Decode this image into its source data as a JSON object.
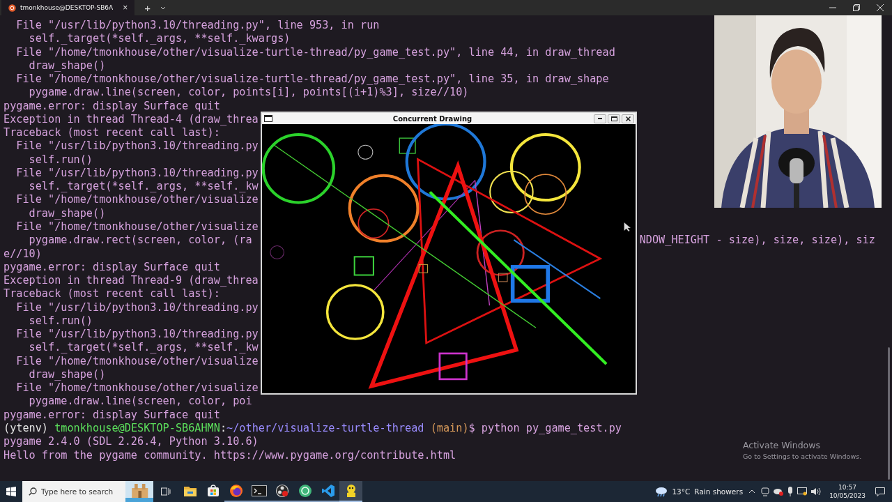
{
  "terminal": {
    "tab": {
      "title": "tmonkhouse@DESKTOP-SB6A",
      "close": "×"
    },
    "new_tab": "+",
    "lines": [
      {
        "kind": "text",
        "text": "  File \"/usr/lib/python3.10/threading.py\", line 953, in run"
      },
      {
        "kind": "text",
        "text": "    self._target(*self._args, **self._kwargs)"
      },
      {
        "kind": "text",
        "text": "  File \"/home/tmonkhouse/other/visualize-turtle-thread/py_game_test.py\", line 44, in draw_thread"
      },
      {
        "kind": "text",
        "text": "    draw_shape()"
      },
      {
        "kind": "text",
        "text": "  File \"/home/tmonkhouse/other/visualize-turtle-thread/py_game_test.py\", line 35, in draw_shape"
      },
      {
        "kind": "text",
        "text": "    pygame.draw.line(screen, color, points[i], points[(i+1)%3], size//10)"
      },
      {
        "kind": "text",
        "text": "pygame.error: display Surface quit"
      },
      {
        "kind": "text",
        "text": "Exception in thread Thread-4 (draw_threa"
      },
      {
        "kind": "text",
        "text": "Traceback (most recent call last):"
      },
      {
        "kind": "text",
        "text": "  File \"/usr/lib/python3.10/threading.py"
      },
      {
        "kind": "text",
        "text": "    self.run()"
      },
      {
        "kind": "text",
        "text": "  File \"/usr/lib/python3.10/threading.py"
      },
      {
        "kind": "text",
        "text": "    self._target(*self._args, **self._kw"
      },
      {
        "kind": "text",
        "text": "  File \"/home/tmonkhouse/other/visualize"
      },
      {
        "kind": "text",
        "text": "    draw_shape()"
      },
      {
        "kind": "text",
        "text": "  File \"/home/tmonkhouse/other/visualize"
      },
      {
        "kind": "split",
        "left": "    pygame.draw.rect(screen, color, (ra",
        "right": "NDOW_HEIGHT - size), size, size), siz"
      },
      {
        "kind": "text",
        "text": "e//10)"
      },
      {
        "kind": "text",
        "text": "pygame.error: display Surface quit"
      },
      {
        "kind": "text",
        "text": "Exception in thread Thread-9 (draw_threa"
      },
      {
        "kind": "text",
        "text": "Traceback (most recent call last):"
      },
      {
        "kind": "text",
        "text": "  File \"/usr/lib/python3.10/threading.py"
      },
      {
        "kind": "text",
        "text": "    self.run()"
      },
      {
        "kind": "text",
        "text": "  File \"/usr/lib/python3.10/threading.py"
      },
      {
        "kind": "text",
        "text": "    self._target(*self._args, **self._kw"
      },
      {
        "kind": "text",
        "text": "  File \"/home/tmonkhouse/other/visualize"
      },
      {
        "kind": "text",
        "text": "    draw_shape()"
      },
      {
        "kind": "text",
        "text": "  File \"/home/tmonkhouse/other/visualize"
      },
      {
        "kind": "text",
        "text": "    pygame.draw.line(screen, color, poi"
      },
      {
        "kind": "text",
        "text": "pygame.error: display Surface quit"
      },
      {
        "kind": "prompt",
        "segments": [
          {
            "kind": "env",
            "text": "(ytenv) "
          },
          {
            "kind": "user",
            "text": "tmonkhouse@DESKTOP-SB6AHMN"
          },
          {
            "kind": "sep",
            "text": ":"
          },
          {
            "kind": "path",
            "text": "~/other/visualize-turtle-thread"
          },
          {
            "kind": "branch",
            "text": " (main)"
          },
          {
            "kind": "command",
            "text": "$ python py_game_test.py"
          }
        ]
      },
      {
        "kind": "text",
        "text": "pygame 2.4.0 (SDL 2.26.4, Python 3.10.6)"
      },
      {
        "kind": "text",
        "text": "Hello from the pygame community. https://www.pygame.org/contribute.html"
      }
    ]
  },
  "pygame_window": {
    "title": "Concurrent Drawing"
  },
  "activation": {
    "title": "Activate Windows",
    "subtitle": "Go to Settings to activate Windows."
  },
  "taskbar": {
    "search": {
      "placeholder": "Type here to search"
    },
    "apps": [
      {
        "kind": "explorer",
        "running": false,
        "selected": false
      },
      {
        "kind": "store",
        "running": false,
        "selected": false
      },
      {
        "kind": "firefox",
        "running": true,
        "selected": false
      },
      {
        "kind": "terminal",
        "running": true,
        "selected": false
      },
      {
        "kind": "obs",
        "running": true,
        "selected": false
      },
      {
        "kind": "orb",
        "running": true,
        "selected": false
      },
      {
        "kind": "vscode",
        "running": true,
        "selected": false
      },
      {
        "kind": "pygame",
        "running": true,
        "selected": true
      }
    ],
    "weather": {
      "temperature": "13°C",
      "condition": "Rain showers"
    },
    "clock": {
      "time": "10:57",
      "date": "10/05/2023"
    }
  }
}
